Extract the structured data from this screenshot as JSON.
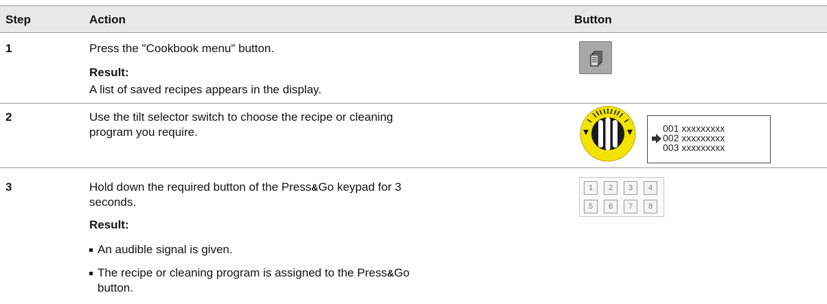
{
  "header": {
    "step_label": "Step",
    "action_label": "Action",
    "button_label": "Button"
  },
  "rows": [
    {
      "step": "1",
      "action": "Press the \"Cookbook menu\" button.",
      "result_label": "Result:",
      "result_text": "A list of saved recipes appears in the display.",
      "button_icon": "cookbook-menu-icon"
    },
    {
      "step": "2",
      "action_line1": "Use the tilt selector switch to choose the recipe or cleaning",
      "action_line2": "program you require.",
      "button_icon": "tilt-selector-switch-icon",
      "display_lines": [
        "001 xxxxxxxxx",
        "002 xxxxxxxxx",
        "003 xxxxxxxxx"
      ],
      "selected_index": 1
    },
    {
      "step": "3",
      "action_line1_pre": "Hold down the required button of the Press",
      "action_line1_amp": "&",
      "action_line1_post": "Go keypad for 3",
      "action_line2": "seconds.",
      "result_label": "Result:",
      "bullet1": "An audible signal is given.",
      "bullet2_pre": "The recipe or cleaning program is assigned to the Press",
      "bullet2_amp": "&",
      "bullet2_post": "Go",
      "bullet2_line2": "button.",
      "keypad_keys": [
        "1",
        "2",
        "3",
        "4",
        "5",
        "6",
        "7",
        "8"
      ]
    }
  ],
  "colors": {
    "header_bg": "#e8e8e8",
    "selector_yellow": "#f2e400",
    "button_gray": "#a8a8a8"
  }
}
